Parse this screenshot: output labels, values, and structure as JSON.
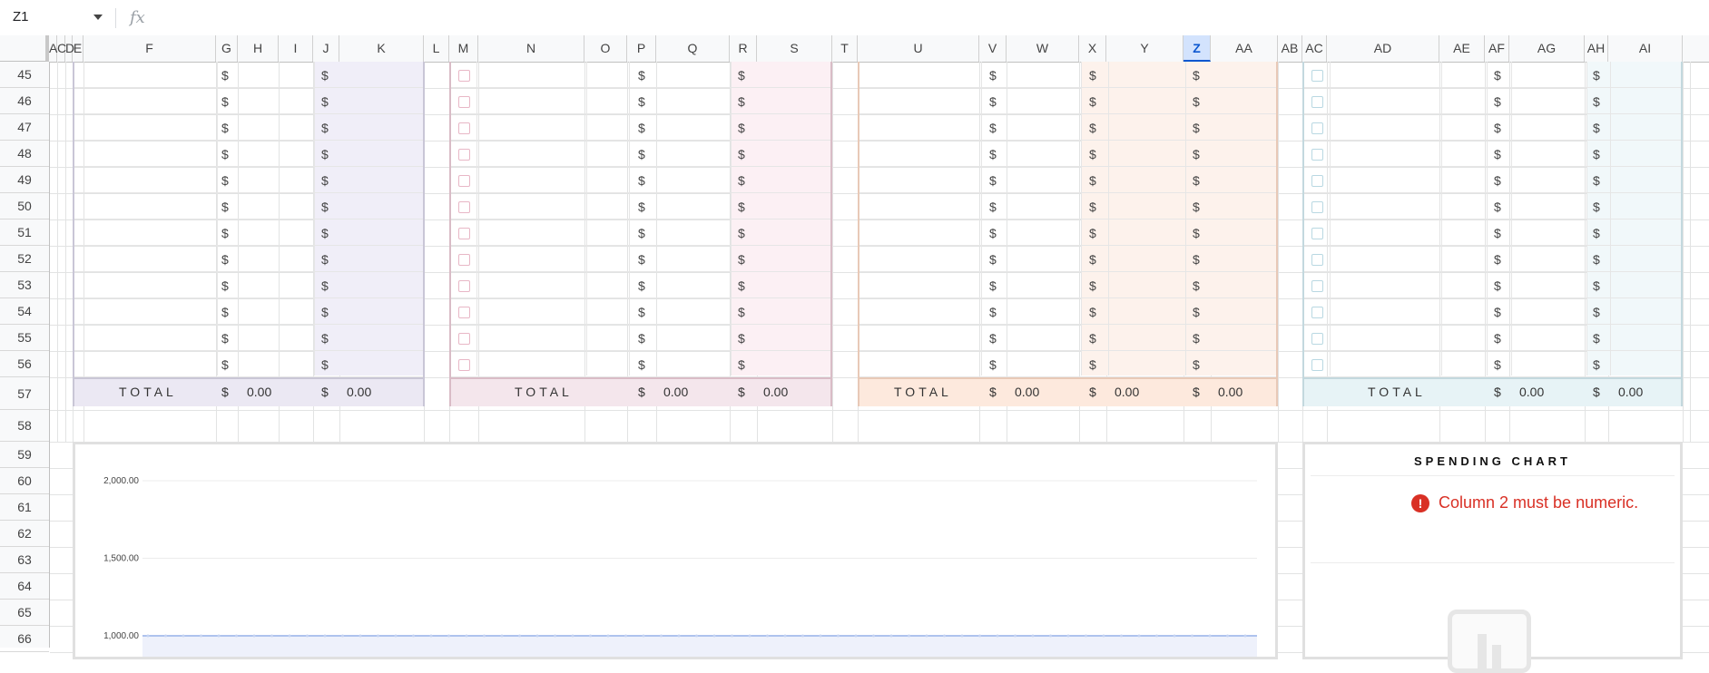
{
  "formula_bar": {
    "cell_ref": "Z1",
    "fx_icon": "fx-icon"
  },
  "columns": [
    "A",
    "C",
    "D",
    "E",
    "F",
    "G",
    "H",
    "I",
    "J",
    "K",
    "L",
    "M",
    "N",
    "O",
    "P",
    "Q",
    "R",
    "S",
    "T",
    "U",
    "V",
    "W",
    "X",
    "Y",
    "Z",
    "AA",
    "AB",
    "AC",
    "AD",
    "AE",
    "AF",
    "AG",
    "AH",
    "AI"
  ],
  "selected_column": "Z",
  "rows": [
    "45",
    "46",
    "47",
    "48",
    "49",
    "50",
    "51",
    "52",
    "53",
    "54",
    "55",
    "56",
    "57",
    "58",
    "59",
    "60",
    "61",
    "62",
    "63",
    "64",
    "65",
    "66"
  ],
  "currency": "$",
  "total_label": "TOTAL",
  "totals": {
    "table1": {
      "planned": "0.00",
      "actual": "0.00"
    },
    "table2": {
      "planned": "0.00",
      "actual": "0.00"
    },
    "table3": {
      "a": "0.00",
      "b": "0.00",
      "c": "0.00"
    },
    "table4": {
      "planned": "0.00",
      "actual": "0.00"
    }
  },
  "colors": {
    "purple_fill": "#f0eef8",
    "purple_border": "#c9c6d6",
    "purple_total": "#ebe8f3",
    "pink_fill": "#fcf0f4",
    "pink_border": "#d9bcc6",
    "pink_total": "#f4e6ec",
    "pink_checkbox": "#e8b7c6",
    "orange_fill": "#fdf2ec",
    "orange_border": "#e8c9b7",
    "orange_total": "#fde9dd",
    "blue_fill": "#f1f8fa",
    "blue_border": "#c3d8de",
    "blue_total": "#e7f3f6",
    "blue_checkbox": "#b9d8e2",
    "error_red": "#d93025"
  },
  "main_chart": {
    "type": "area",
    "y_ticks": [
      "2,000.00",
      "1,500.00",
      "1,000.00"
    ]
  },
  "spending_chart": {
    "title": "SPENDING CHART",
    "error_message": "Column 2 must be numeric.",
    "error_icon": "error-icon",
    "placeholder_icon": "chart-placeholder-icon"
  }
}
